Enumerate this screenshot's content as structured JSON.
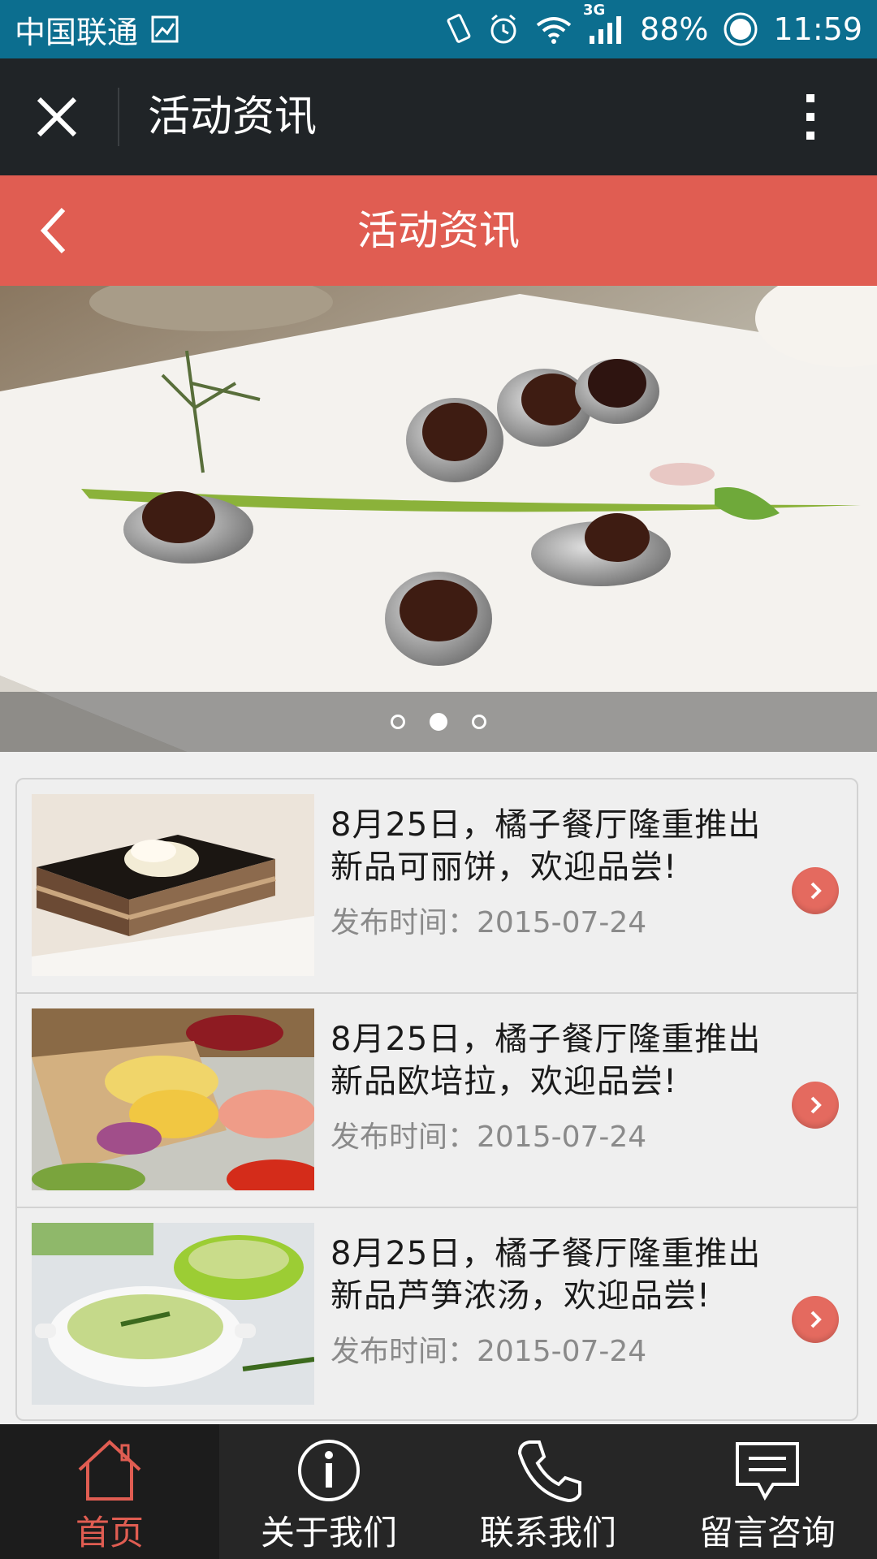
{
  "status_bar": {
    "carrier": "中国联通",
    "network": "3G",
    "battery": "88%",
    "time": "11:59"
  },
  "wechat_bar": {
    "title": "活动资讯"
  },
  "page_header": {
    "title": "活动资讯"
  },
  "banner": {
    "slide_count": 3,
    "active_slide": 2
  },
  "news": [
    {
      "title": "8月25日，橘子餐厅隆重推出新品可丽饼，欢迎品尝!",
      "time": "发布时间：2015-07-24"
    },
    {
      "title": "8月25日，橘子餐厅隆重推出新品欧培拉，欢迎品尝!",
      "time": "发布时间：2015-07-24"
    },
    {
      "title": "8月25日，橘子餐厅隆重推出新品芦笋浓汤，欢迎品尝!",
      "time": "发布时间：2015-07-24"
    }
  ],
  "bottom_nav": [
    {
      "label": "首页",
      "icon": "home-icon",
      "active": true
    },
    {
      "label": "关于我们",
      "icon": "info-icon",
      "active": false
    },
    {
      "label": "联系我们",
      "icon": "phone-icon",
      "active": false
    },
    {
      "label": "留言咨询",
      "icon": "message-icon",
      "active": false
    }
  ],
  "colors": {
    "status_bar": "#0c6e8f",
    "wechat_bar": "#202427",
    "accent": "#e05d52",
    "nav_bg": "#262626"
  }
}
